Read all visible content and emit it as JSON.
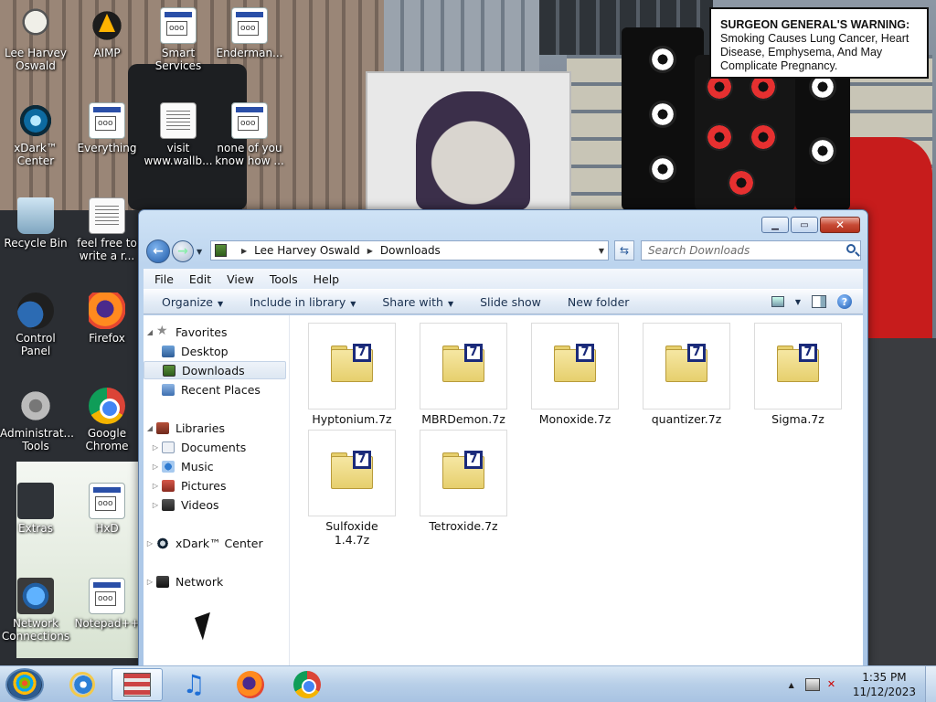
{
  "warning": {
    "title": "SURGEON GENERAL'S WARNING:",
    "body": "Smoking Causes Lung Cancer, Heart Disease, Emphysema, And May Complicate Pregnancy."
  },
  "desktop_icons": [
    {
      "label": "Lee Harvey Oswald",
      "icon": "user-icon"
    },
    {
      "label": "AIMP",
      "icon": "aimp-icon"
    },
    {
      "label": "Smart Services",
      "icon": "program-icon"
    },
    {
      "label": "Enderman...",
      "icon": "program-icon"
    },
    {
      "label": "xDark™ Center",
      "icon": "xdark-icon"
    },
    {
      "label": "Everything",
      "icon": "program-icon"
    },
    {
      "label": "visit www.wallb...",
      "icon": "document-icon"
    },
    {
      "label": "none of you know how ...",
      "icon": "program-icon"
    },
    {
      "label": "Recycle Bin",
      "icon": "recycle-bin-icon"
    },
    {
      "label": "feel free to write a r...",
      "icon": "document-icon"
    },
    {
      "label": "Control Panel",
      "icon": "control-panel-icon"
    },
    {
      "label": "Firefox",
      "icon": "firefox-icon"
    },
    {
      "label": "Administrat... Tools",
      "icon": "gear-icon"
    },
    {
      "label": "Google Chrome",
      "icon": "chrome-icon"
    },
    {
      "label": "Extras",
      "icon": "folder-icon"
    },
    {
      "label": "HxD",
      "icon": "program-icon"
    },
    {
      "label": "Network Connections",
      "icon": "network-icon"
    },
    {
      "label": "Notepad++",
      "icon": "program-icon"
    }
  ],
  "window": {
    "address": {
      "root": "Lee Harvey Oswald",
      "current": "Downloads"
    },
    "search_placeholder": "Search Downloads",
    "menu": [
      "File",
      "Edit",
      "View",
      "Tools",
      "Help"
    ],
    "toolbar": [
      "Organize",
      "Include in library",
      "Share with",
      "Slide show",
      "New folder"
    ],
    "nav": {
      "favorites": "Favorites",
      "desktop": "Desktop",
      "downloads": "Downloads",
      "recent": "Recent Places",
      "libraries": "Libraries",
      "documents": "Documents",
      "music": "Music",
      "pictures": "Pictures",
      "videos": "Videos",
      "xdark": "xDark™ Center",
      "network": "Network"
    },
    "files": [
      "Hyptonium.7z",
      "MBRDemon.7z",
      "Monoxide.7z",
      "quantizer.7z",
      "Sigma.7z",
      "Sulfoxide 1.4.7z",
      "Tetroxide.7z"
    ],
    "badge_glyph": "7"
  },
  "taskbar": {
    "time": "1:35 PM",
    "date": "11/12/2023"
  }
}
